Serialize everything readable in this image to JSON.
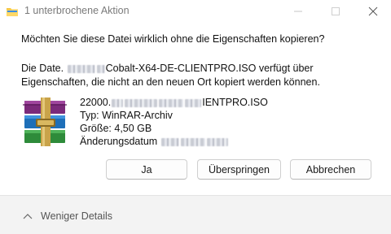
{
  "window": {
    "title": "1 unterbrochene Aktion"
  },
  "dialog": {
    "question": "Möchten Sie diese Datei wirklich ohne die Eigenschaften kopieren?",
    "desc_prefix": "Die Date.",
    "desc_suffix": "Cobalt-X64-DE-CLIENTPRO.ISO verfügt über",
    "desc_line2": "Eigenschaften, die nicht an den neuen Ort kopiert werden können."
  },
  "file": {
    "name_start": "22000.",
    "name_end": "IENTPRO.ISO",
    "type": "Typ: WinRAR-Archiv",
    "size": "Größe: 4,50 GB",
    "modified_label": "Änderungsdatum"
  },
  "buttons": {
    "yes": "Ja",
    "skip": "Überspringen",
    "cancel": "Abbrechen"
  },
  "footer": {
    "less_details": "Weniger Details"
  }
}
